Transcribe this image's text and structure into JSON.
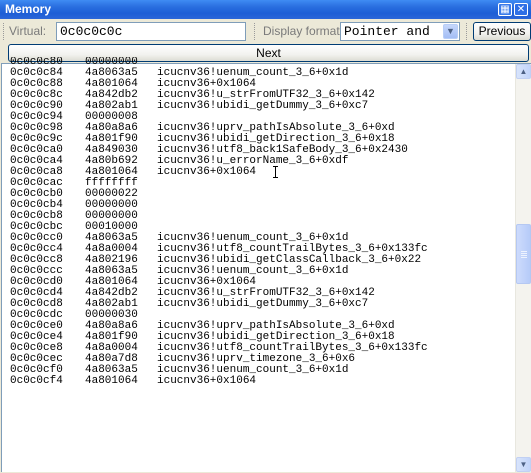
{
  "window": {
    "title": "Memory"
  },
  "toolbar": {
    "virtual_label": "Virtual:",
    "virtual_value": "0c0c0c0c",
    "format_label": "Display format:",
    "format_value": "Pointer and",
    "previous_label": "Previous",
    "next_label": "Next"
  },
  "memory_rows": [
    {
      "addr": "0c0c0c80",
      "val": "00000000",
      "sym": ""
    },
    {
      "addr": "0c0c0c84",
      "val": "4a8063a5",
      "sym": "icucnv36!uenum_count_3_6+0x1d"
    },
    {
      "addr": "0c0c0c88",
      "val": "4a801064",
      "sym": "icucnv36+0x1064"
    },
    {
      "addr": "0c0c0c8c",
      "val": "4a842db2",
      "sym": "icucnv36!u_strFromUTF32_3_6+0x142"
    },
    {
      "addr": "0c0c0c90",
      "val": "4a802ab1",
      "sym": "icucnv36!ubidi_getDummy_3_6+0xc7"
    },
    {
      "addr": "0c0c0c94",
      "val": "00000008",
      "sym": ""
    },
    {
      "addr": "0c0c0c98",
      "val": "4a80a8a6",
      "sym": "icucnv36!uprv_pathIsAbsolute_3_6+0xd"
    },
    {
      "addr": "0c0c0c9c",
      "val": "4a801f90",
      "sym": "icucnv36!ubidi_getDirection_3_6+0x18"
    },
    {
      "addr": "0c0c0ca0",
      "val": "4a849030",
      "sym": "icucnv36!utf8_back1SafeBody_3_6+0x2430"
    },
    {
      "addr": "0c0c0ca4",
      "val": "4a80b692",
      "sym": "icucnv36!u_errorName_3_6+0xdf"
    },
    {
      "addr": "0c0c0ca8",
      "val": "4a801064",
      "sym": "icucnv36+0x1064"
    },
    {
      "addr": "0c0c0cac",
      "val": "ffffffff",
      "sym": ""
    },
    {
      "addr": "0c0c0cb0",
      "val": "00000022",
      "sym": ""
    },
    {
      "addr": "0c0c0cb4",
      "val": "00000000",
      "sym": ""
    },
    {
      "addr": "0c0c0cb8",
      "val": "00000000",
      "sym": ""
    },
    {
      "addr": "0c0c0cbc",
      "val": "00010000",
      "sym": ""
    },
    {
      "addr": "0c0c0cc0",
      "val": "4a8063a5",
      "sym": "icucnv36!uenum_count_3_6+0x1d"
    },
    {
      "addr": "0c0c0cc4",
      "val": "4a8a0004",
      "sym": "icucnv36!utf8_countTrailBytes_3_6+0x133fc"
    },
    {
      "addr": "0c0c0cc8",
      "val": "4a802196",
      "sym": "icucnv36!ubidi_getClassCallback_3_6+0x22"
    },
    {
      "addr": "0c0c0ccc",
      "val": "4a8063a5",
      "sym": "icucnv36!uenum_count_3_6+0x1d"
    },
    {
      "addr": "0c0c0cd0",
      "val": "4a801064",
      "sym": "icucnv36+0x1064"
    },
    {
      "addr": "0c0c0cd4",
      "val": "4a842db2",
      "sym": "icucnv36!u_strFromUTF32_3_6+0x142"
    },
    {
      "addr": "0c0c0cd8",
      "val": "4a802ab1",
      "sym": "icucnv36!ubidi_getDummy_3_6+0xc7"
    },
    {
      "addr": "0c0c0cdc",
      "val": "00000030",
      "sym": ""
    },
    {
      "addr": "0c0c0ce0",
      "val": "4a80a8a6",
      "sym": "icucnv36!uprv_pathIsAbsolute_3_6+0xd"
    },
    {
      "addr": "0c0c0ce4",
      "val": "4a801f90",
      "sym": "icucnv36!ubidi_getDirection_3_6+0x18"
    },
    {
      "addr": "0c0c0ce8",
      "val": "4a8a0004",
      "sym": "icucnv36!utf8_countTrailBytes_3_6+0x133fc"
    },
    {
      "addr": "0c0c0cec",
      "val": "4a80a7d8",
      "sym": "icucnv36!uprv_timezone_3_6+0x6"
    },
    {
      "addr": "0c0c0cf0",
      "val": "4a8063a5",
      "sym": "icucnv36!uenum_count_3_6+0x1d"
    },
    {
      "addr": "0c0c0cf4",
      "val": "4a801064",
      "sym": "icucnv36+0x1064"
    }
  ]
}
